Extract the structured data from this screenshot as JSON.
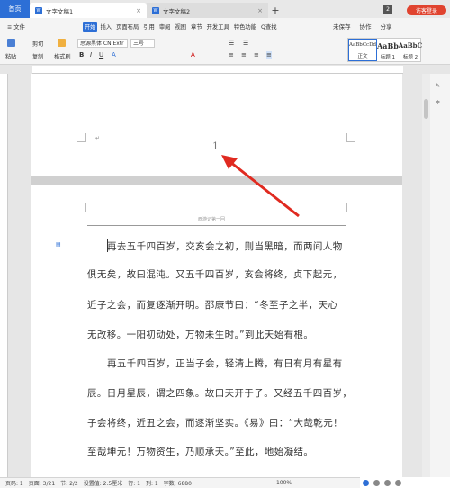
{
  "tabs": {
    "home": "首页",
    "doc1": "文字文稿1",
    "doc2": "文字文稿2",
    "add": "+",
    "count_badge": "2",
    "guest": "访客登录"
  },
  "menu": {
    "file": "≡ 文件",
    "items": [
      "开始",
      "插入",
      "页面布局",
      "引用",
      "审阅",
      "视图",
      "章节",
      "开发工具",
      "特色功能"
    ],
    "search": "Q查找",
    "unsaved": "未保存",
    "collab": "协作",
    "share": "分享"
  },
  "ribbon": {
    "paste": "粘贴",
    "cut": "剪切",
    "copy": "复制",
    "format_painter": "格式刷",
    "font_name": "思源黑体 CN Extr",
    "font_size": "三号",
    "styles": [
      {
        "sample": "AaBbCcDd",
        "name": "正文"
      },
      {
        "sample": "AaBb",
        "name": "标题 1"
      },
      {
        "sample": "AaBbC",
        "name": "标题 2"
      }
    ]
  },
  "document": {
    "page_number": "1",
    "header_text": "西游记第一回",
    "paragraphs": [
      "再去五千四百岁，交亥会之初，则当黑暗，而两间人物",
      "俱无矣，故曰混沌。又五千四百岁，亥会将终，贞下起元，",
      "近子之会，而复逐渐开明。邵康节曰：“冬至子之半，天心",
      "无改移。一阳初动处，万物未生时。”到此天始有根。",
      "再五千四百岁，正当子会，轻清上腾，有日有月有星有",
      "辰。日月星辰，谓之四象。故曰天开于子。又经五千四百岁，",
      "子会将终，近丑之会，而逐渐坚实。《易》曰：“大哉乾元！",
      "至哉坤元！万物资生，乃顺承天。”至此，地始凝结。"
    ]
  },
  "status": {
    "page_no": "页码: 1",
    "pages": "页面: 3/21",
    "section": "节: 2/2",
    "setting": "设置值: 2.5厘米",
    "line": "行: 1",
    "column": "列: 1",
    "word_count": "字数: 6880",
    "zoom": "100%"
  }
}
